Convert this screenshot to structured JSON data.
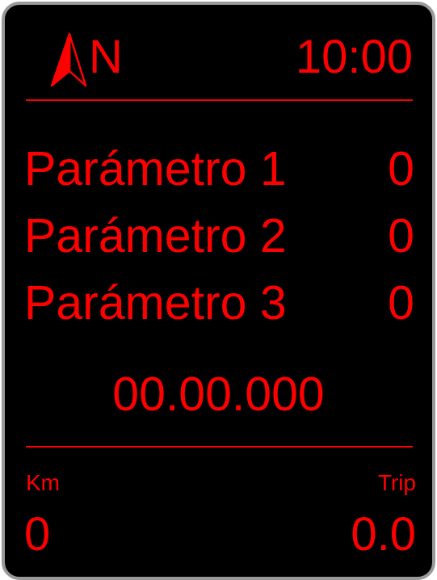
{
  "colors": {
    "text": "#ff0000",
    "background": "#000000",
    "frame": "#9a9a9a"
  },
  "header": {
    "compass_icon": "north-arrow-icon",
    "heading": "N",
    "time": "10:00"
  },
  "parameters": [
    {
      "label": "Parámetro 1",
      "value": "0"
    },
    {
      "label": "Parámetro 2",
      "value": "0"
    },
    {
      "label": "Parámetro 3",
      "value": "0"
    }
  ],
  "odometer": "00.00.000",
  "footer": {
    "km_label": "Km",
    "km_value": "0",
    "trip_label": "Trip",
    "trip_value": "0.0"
  }
}
